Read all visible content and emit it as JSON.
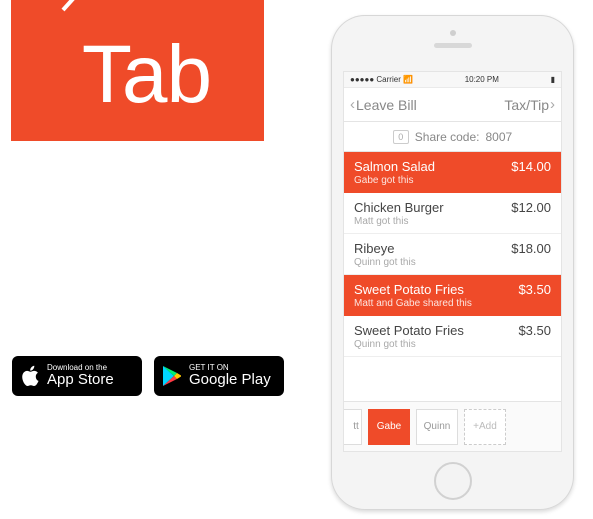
{
  "logo": {
    "text": "Tab"
  },
  "store": {
    "apple": {
      "small": "Download on the",
      "big": "App Store"
    },
    "google": {
      "small": "GET IT ON",
      "big": "Google Play"
    }
  },
  "status": {
    "carrier": "Carrier",
    "signal": "●●●●●",
    "time": "10:20 PM"
  },
  "nav": {
    "left": "Leave Bill",
    "right": "Tax/Tip"
  },
  "share": {
    "zero": "0",
    "label": "Share code:",
    "code": "8007"
  },
  "items": [
    {
      "name": "Salmon Salad",
      "price": "$14.00",
      "sub": "Gabe got this",
      "sel": true
    },
    {
      "name": "Chicken Burger",
      "price": "$12.00",
      "sub": "Matt got this",
      "sel": false
    },
    {
      "name": "Ribeye",
      "price": "$18.00",
      "sub": "Quinn got this",
      "sel": false
    },
    {
      "name": "Sweet Potato Fries",
      "price": "$3.50",
      "sub": "Matt and Gabe shared this",
      "sel": true
    },
    {
      "name": "Sweet Potato Fries",
      "price": "$3.50",
      "sub": "Quinn got this",
      "sel": false
    }
  ],
  "people": {
    "partial": "tt",
    "list": [
      "Gabe",
      "Quinn"
    ],
    "active": "Gabe",
    "add": "+Add"
  },
  "colors": {
    "accent": "#ef4b29"
  }
}
